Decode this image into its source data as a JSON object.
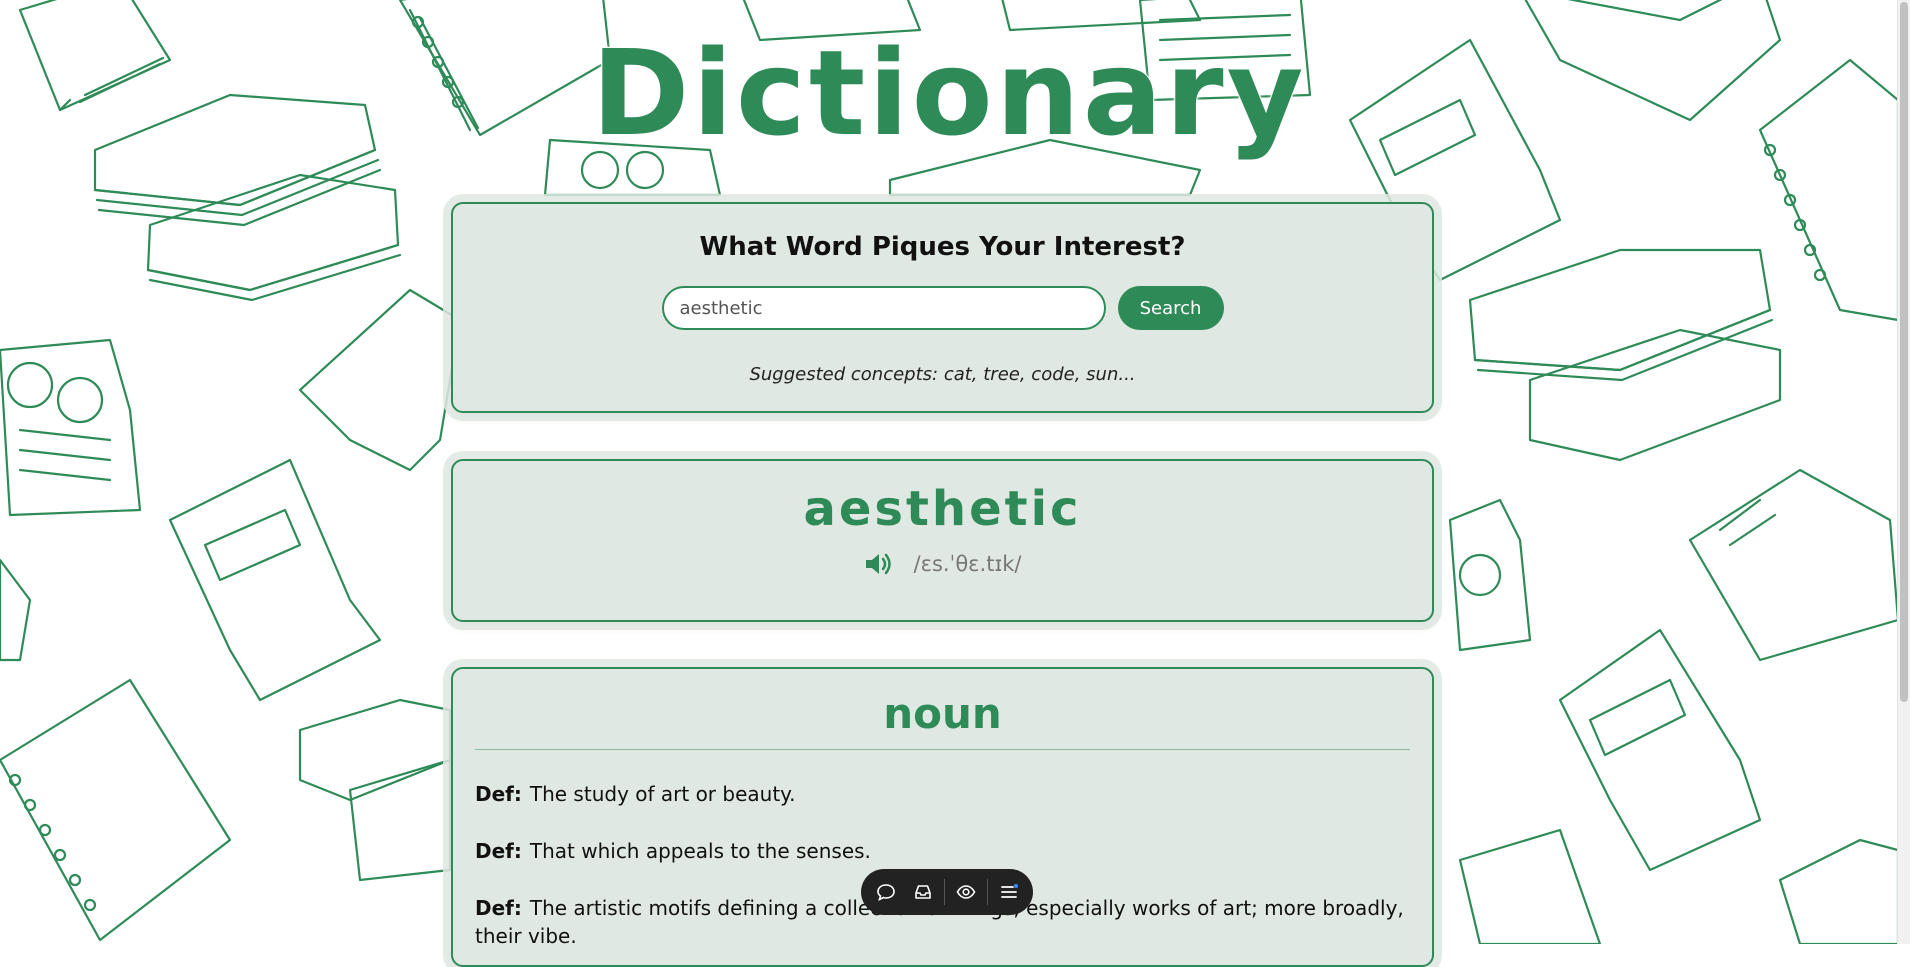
{
  "app": {
    "title": "Dictionary"
  },
  "search": {
    "heading": "What Word Piques Your Interest?",
    "input_value": "aesthetic",
    "input_placeholder": "",
    "button_label": "Search",
    "suggestions": "Suggested concepts: cat, tree, code, sun..."
  },
  "entry": {
    "word": "aesthetic",
    "phonetic": "/ɛs.ˈθɛ.tɪk/",
    "audio_icon": "speaker-icon"
  },
  "meaning": {
    "part_of_speech": "noun",
    "def_label": "Def:",
    "definitions": [
      "The study of art or beauty.",
      "That which appeals to the senses.",
      "The artistic motifs defining a collection of things, especially works of art; more broadly, their vibe."
    ]
  },
  "toolbar": {
    "icons": [
      "comment-icon",
      "inbox-icon",
      "eye-icon",
      "menu-icon"
    ]
  },
  "colors": {
    "accent": "#2e8b57",
    "card_bg": "#dfe8e2",
    "toolbar_bg": "#222222"
  }
}
